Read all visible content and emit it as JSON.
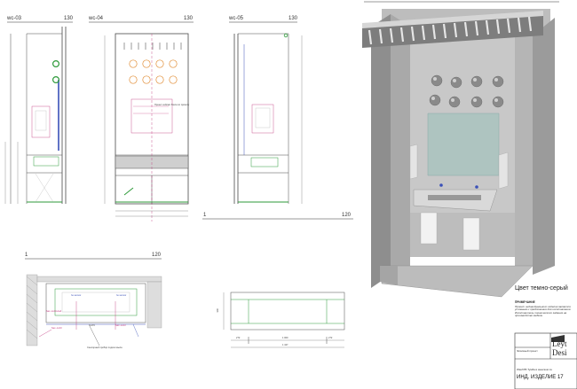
{
  "views": {
    "wc03": {
      "title": "wc-03",
      "scale": "130"
    },
    "wc04": {
      "title": "wc-04",
      "scale": "130"
    },
    "wc05": {
      "title": "wc-05",
      "scale": "130"
    },
    "section_mid": {
      "title": "1",
      "scale": "120"
    },
    "plan": {
      "title": "1",
      "scale": "120"
    }
  },
  "annotations": {
    "wc04_note": "Проект сейсмо бокса по проекту",
    "plan_sensor": "Сенсорный прибор подачи мыла",
    "plan_dim_a": "1476",
    "plan_label_1": "Sec.-A-03-Aud",
    "plan_label_2": "Sec.-A-03",
    "plan_label_3": "Sec.-A-03",
    "plan_label_4": "№ sensor",
    "plan_label_5": "№ sensor"
  },
  "front_view": {
    "dims": [
      "272",
      "1 000",
      "272"
    ],
    "total": "1 427",
    "height": "300"
  },
  "color_heading": "Цвет темно-серый",
  "notes": {
    "title": "ПРИМЕЧАНИЕ",
    "body": "Проект индивидуального изделия является условным и предложения для изготовления. Изготовитель технического задания на производство мебели."
  },
  "title_block": {
    "logo_text_1": "Leyt",
    "logo_text_2": "Desi",
    "stage": "Эскизный проект",
    "item_desc": "WashTB Тумба в женском сн",
    "item_code": "ИНД. ИЗДЕЛИЕ 17"
  },
  "colors": {
    "line": "#4a4a4a",
    "green": "#2e9a3a",
    "pink": "#c0307a",
    "blue": "#3a50b8",
    "orange": "#e08a30",
    "render_grey": "#9a9a9a"
  }
}
